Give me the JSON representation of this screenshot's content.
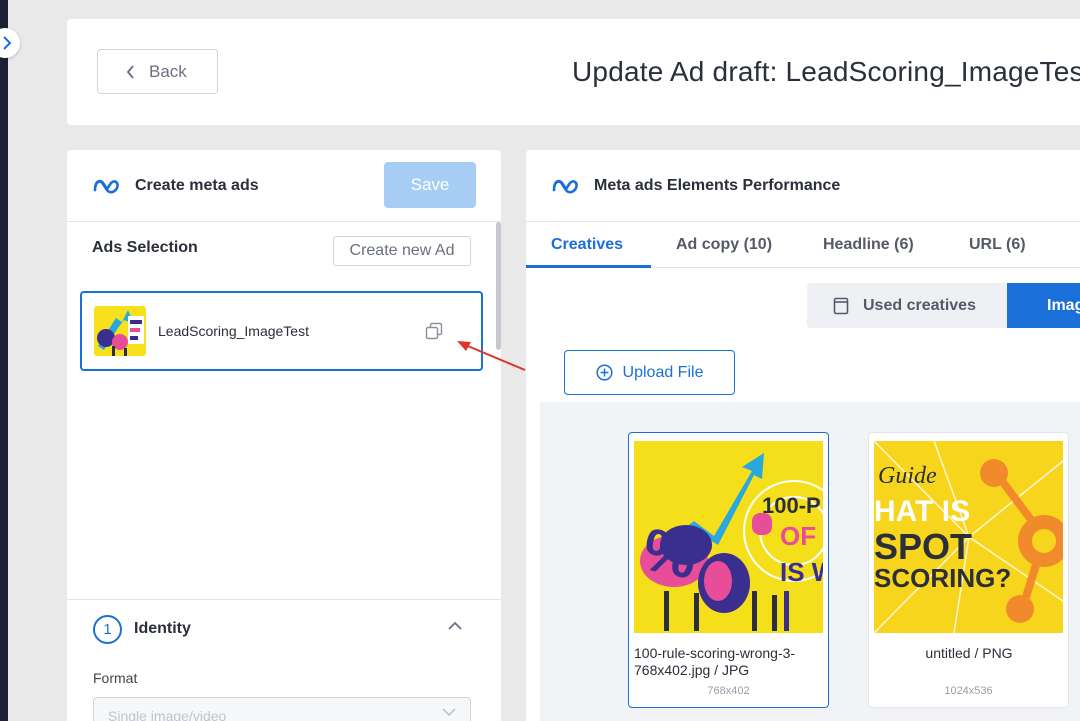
{
  "header": {
    "back_label": "Back",
    "title": "Update Ad draft: LeadScoring_ImageTest"
  },
  "left_panel": {
    "title": "Create meta ads",
    "save_label": "Save",
    "ads_selection_label": "Ads Selection",
    "create_new_label": "Create new Ad",
    "ads": [
      {
        "name": "LeadScoring_ImageTest"
      }
    ],
    "identity": {
      "step": "1",
      "title": "Identity",
      "format_label": "Format",
      "format_value": "Single image/video"
    }
  },
  "right_panel": {
    "title": "Meta ads Elements Performance",
    "tabs": [
      {
        "label": "Creatives"
      },
      {
        "label": "Ad copy (10)"
      },
      {
        "label": "Headline (6)"
      },
      {
        "label": "URL (6)"
      }
    ],
    "used_creatives_label": "Used creatives",
    "images_label": "Images",
    "upload_label": "Upload File",
    "images": [
      {
        "name": "100-rule-scoring-wrong-3-768x402.jpg / JPG",
        "dims": "768x402"
      },
      {
        "name": "untitled / PNG",
        "dims": "1024x536"
      }
    ]
  },
  "colors": {
    "accent": "#1a6fd8",
    "save_disabled": "#a8cdf5",
    "annotation_arrow": "#e0332a"
  }
}
